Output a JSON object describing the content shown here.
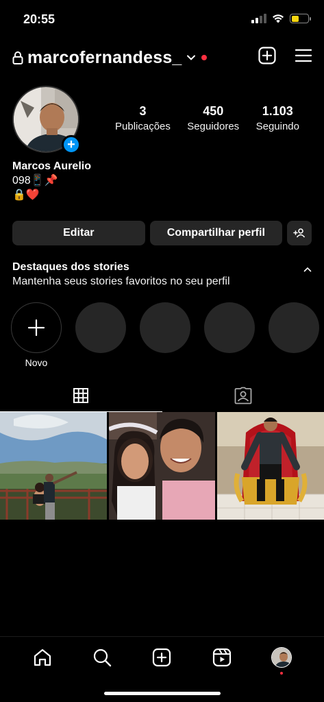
{
  "status_bar": {
    "time": "20:55",
    "battery_level": 0.45,
    "battery_color": "#f5d40f"
  },
  "header": {
    "username": "marcofernandess_",
    "icons": [
      "lock-icon",
      "chevron-down-icon",
      "create-plus-icon",
      "menu-icon"
    ]
  },
  "profile": {
    "stats": [
      {
        "value": "3",
        "label": "Publicações"
      },
      {
        "value": "450",
        "label": "Seguidores"
      },
      {
        "value": "1.103",
        "label": "Seguindo"
      }
    ],
    "name": "Marcos Aurelio",
    "bio_line1": "098📱📌",
    "bio_line2": "🔒❤️"
  },
  "buttons": {
    "edit": "Editar",
    "share": "Compartilhar perfil"
  },
  "highlights": {
    "title": "Destaques dos stories",
    "subtitle": "Mantenha seus stories favoritos no seu perfil",
    "new_label": "Novo",
    "empty_count": 4
  },
  "tabs": [
    {
      "icon": "grid-icon",
      "active": true
    },
    {
      "icon": "tagged-icon",
      "active": false
    }
  ],
  "posts": [
    "post-landscape-couple",
    "post-selfie-party",
    "post-throne"
  ],
  "bottom_nav": [
    "home-icon",
    "search-icon",
    "create-icon",
    "reels-icon",
    "profile-avatar"
  ],
  "colors": {
    "accent": "#0095f6",
    "notification": "#ff3040",
    "button_bg": "#262626"
  }
}
